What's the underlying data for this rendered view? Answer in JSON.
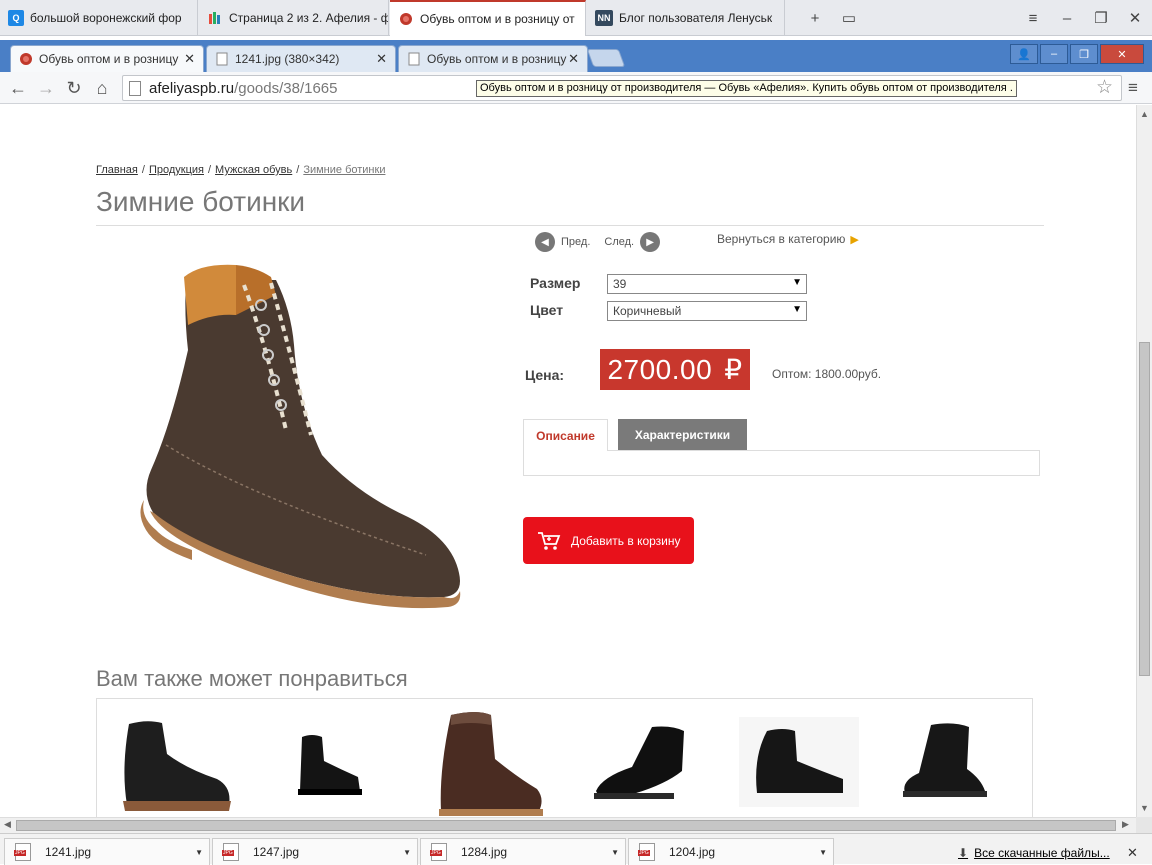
{
  "outer_tabs": [
    {
      "title": "большой воронежский фор",
      "fav_color": "#1e88e5",
      "fav_text": "Q"
    },
    {
      "title": "Страница 2 из 2. Афелия - ф",
      "fav_color": "#f5f5f5",
      "fav_text": ""
    },
    {
      "title": "Обувь оптом и в розницу от",
      "fav_color": "#c0392b",
      "fav_text": ""
    },
    {
      "title": "Блог пользователя Ленуськ",
      "fav_color": "#34495e",
      "fav_text": "NN"
    }
  ],
  "outer_controls": {
    "new_tab": "+",
    "tab_list": "▭",
    "menu": "≡",
    "minimize": "–",
    "restore": "❐",
    "close": "✕"
  },
  "inner_tabs": [
    {
      "title": "Обувь оптом и в розницу",
      "close": "✕"
    },
    {
      "title": "1241.jpg (380×342)",
      "close": "✕"
    },
    {
      "title": "Обувь оптом и в розницу",
      "close": "✕"
    }
  ],
  "window_buttons": {
    "user": "👤",
    "minimize": "–",
    "restore": "❐",
    "close": "✕"
  },
  "toolbar": {
    "back": "←",
    "forward": "→",
    "reload": "↻",
    "home": "⌂",
    "star": "☆",
    "menu": "≡"
  },
  "address": {
    "host": "afeliyaspb.ru",
    "path": "/goods/38/1665"
  },
  "tooltip": "Обувь оптом и в розницу от производителя — Обувь «Афелия». Купить обувь оптом от производителя .",
  "breadcrumbs": [
    {
      "label": "Главная"
    },
    {
      "label": "Продукция"
    },
    {
      "label": "Мужская обувь"
    },
    {
      "label": "Зимние ботинки"
    }
  ],
  "breadcrumb_sep": "/",
  "product": {
    "title": "Зимние ботинки",
    "prev": "Пред.",
    "next": "След.",
    "back_to_category": "Вернуться в категорию",
    "size_label": "Размер",
    "size_value": "39",
    "color_label": "Цвет",
    "color_value": "Коричневый",
    "price_label": "Цена:",
    "price": "2700.00",
    "currency": "₽",
    "wholesale": "Оптом: 1800.00руб.",
    "tab_description": "Описание",
    "tab_specs": "Характеристики",
    "add_to_cart": "Добавить в корзину"
  },
  "related": {
    "title": "Вам также может понравиться",
    "item_count": 6
  },
  "downloads": [
    {
      "name": "1241.jpg"
    },
    {
      "name": "1247.jpg"
    },
    {
      "name": "1284.jpg"
    },
    {
      "name": "1204.jpg"
    }
  ],
  "all_downloads": "Все скачанные файлы...",
  "colors": {
    "accent_red": "#c8372d",
    "cart_red": "#e8111b",
    "chrome_blue": "#4a7fc6",
    "leather_brown": "#4a3a30",
    "sole_tan": "#b07d4f"
  }
}
